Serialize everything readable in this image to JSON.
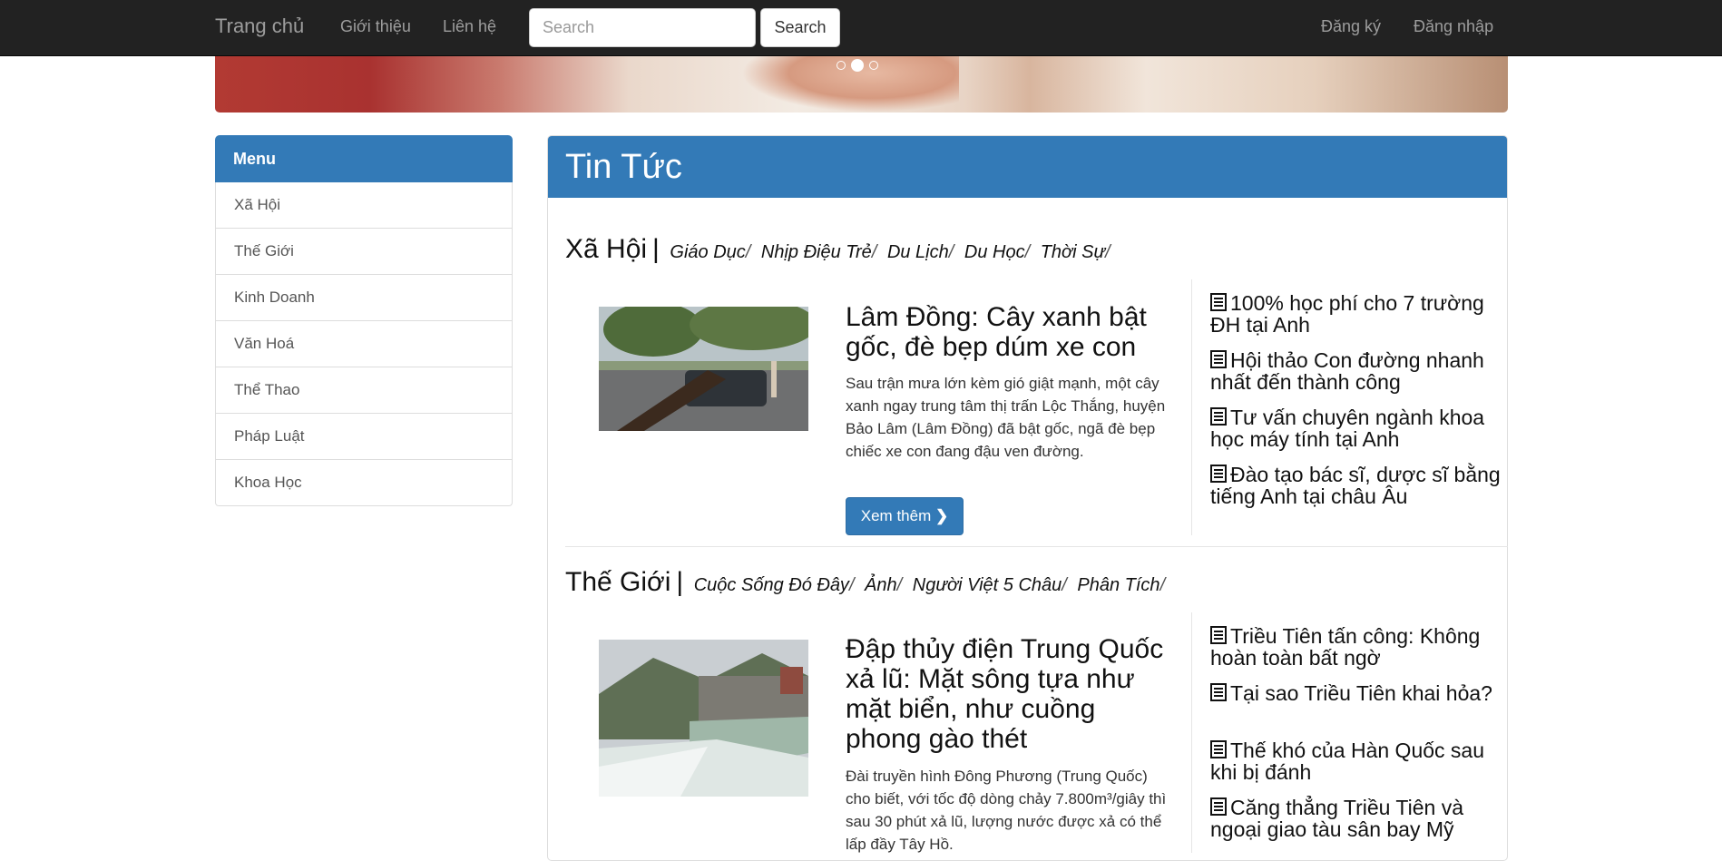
{
  "navbar": {
    "brand": "Trang chủ",
    "links": [
      "Giới thiệu",
      "Liên hệ"
    ],
    "search_placeholder": "Search",
    "search_button": "Search",
    "right_links": [
      "Đăng ký",
      "Đăng nhập"
    ]
  },
  "carousel": {
    "slide_count": 3,
    "active_index": 1
  },
  "sidebar": {
    "title": "Menu",
    "items": [
      "Xã Hội",
      "Thế Giới",
      "Kinh Doanh",
      "Văn Hoá",
      "Thể Thao",
      "Pháp Luật",
      "Khoa Học"
    ]
  },
  "main": {
    "title": "Tin Tức",
    "sections": [
      {
        "name": "Xã Hội",
        "subcategories": [
          "Giáo Dục",
          "Nhịp Điệu Trẻ",
          "Du Lịch",
          "Du Học",
          "Thời Sự"
        ],
        "headline": "Lâm Đồng: Cây xanh bật gốc, đè bẹp dúm xe con",
        "summary": "Sau trận mưa lớn kèm gió giật mạnh, một cây xanh ngay trung tâm thị trấn Lộc Thắng, huyện Bảo Lâm (Lâm Đồng) đã bật gốc, ngã đè bẹp chiếc xe con đang đậu ven đường.",
        "more_button": "Xem thêm",
        "related": [
          "100% học phí cho 7 trường ĐH tại Anh",
          "Hội thảo Con đường nhanh nhất đến thành công",
          "Tư vấn chuyên ngành khoa học máy tính tại Anh",
          "Đào tạo bác sĩ, dược sĩ bằng tiếng Anh tại châu Âu"
        ]
      },
      {
        "name": "Thế Giới",
        "subcategories": [
          "Cuộc Sống Đó Đây",
          "Ảnh",
          "Người Việt 5 Châu",
          "Phân Tích"
        ],
        "headline": "Đập thủy điện Trung Quốc xả lũ: Mặt sông tựa như mặt biển, như cuồng phong gào thét",
        "summary": "Đài truyền hình Đông Phương (Trung Quốc) cho biết, với tốc độ dòng chảy 7.800m³/giây thì sau 30 phút xả lũ, lượng nước được xả có thể lấp đầy Tây Hồ.",
        "related": [
          "Triều Tiên tấn công: Không hoàn toàn bất ngờ",
          "Tại sao Triều Tiên khai hỏa?",
          "Thế khó của Hàn Quốc sau khi bị đánh",
          "Căng thẳng Triều Tiên và ngoại giao tàu sân bay Mỹ"
        ]
      }
    ]
  },
  "colors": {
    "navbar_bg": "#222222",
    "primary": "#337ab7",
    "nav_text": "#9d9d9d"
  }
}
